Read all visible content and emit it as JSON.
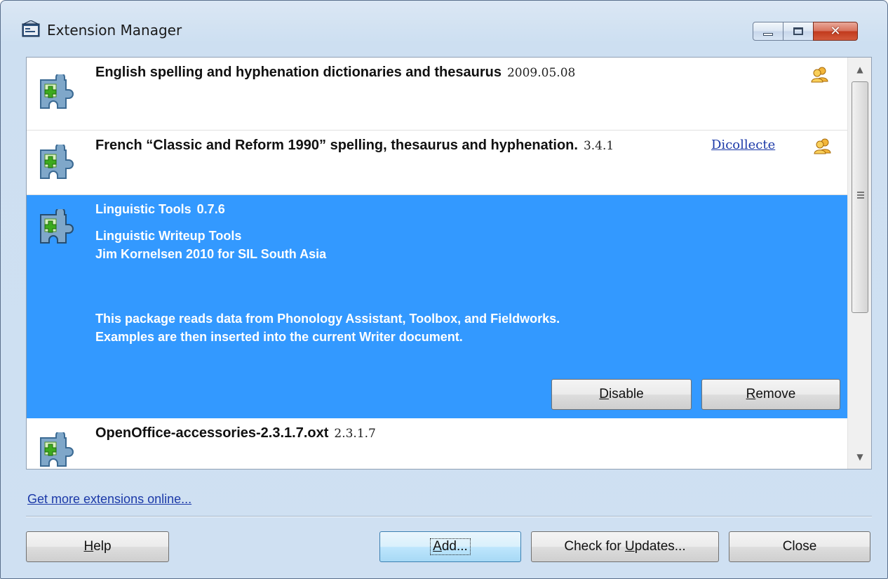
{
  "window": {
    "title": "Extension Manager",
    "caption": {
      "minimize": "minimize-icon",
      "maximize": "maximize-icon",
      "close": "✕"
    }
  },
  "extensions": [
    {
      "title": "English spelling and hyphenation dictionaries and thesaurus",
      "version": "2009.05.08",
      "publisher": "",
      "shared": true,
      "selected": false
    },
    {
      "title": "French “Classic and Reform 1990” spelling, thesaurus and hyphenation.",
      "version": "3.4.1",
      "publisher": "Dicollecte",
      "shared": true,
      "selected": false
    },
    {
      "title": "Linguistic Tools",
      "version": "0.7.6",
      "selected": true,
      "description_lines": [
        "Linguistic Writeup Tools",
        "Jim Kornelsen 2010 for SIL South Asia"
      ],
      "detail_lines": [
        "This package reads data from Phonology Assistant, Toolbox, and Fieldworks.",
        "Examples are then inserted into the current Writer document."
      ],
      "actions": {
        "disable": "Disable",
        "remove": "Remove"
      }
    },
    {
      "title": "OpenOffice-accessories-2.3.1.7.oxt",
      "version": "2.3.1.7",
      "selected": false
    }
  ],
  "links": {
    "get_more": "Get more extensions online..."
  },
  "buttons": {
    "help": "Help",
    "add": "Add...",
    "check_updates": "Check for Updates...",
    "close": "Close"
  },
  "colors": {
    "selection": "#3399ff",
    "link": "#1b39a8",
    "window_bg": "#cfe0f2"
  },
  "icons": [
    "extension-puzzle-icon",
    "shared-users-icon",
    "app-icon"
  ]
}
